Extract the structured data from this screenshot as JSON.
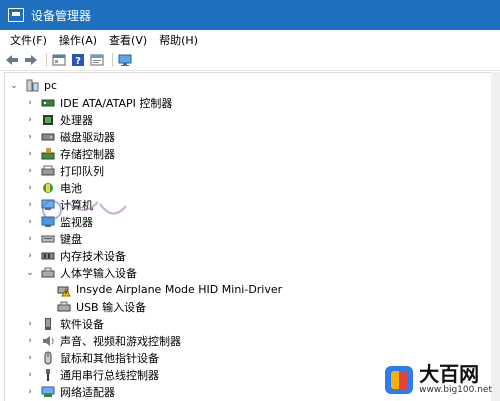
{
  "window": {
    "title": "设备管理器"
  },
  "menu": [
    "文件(F)",
    "操作(A)",
    "查看(V)",
    "帮助(H)"
  ],
  "toolbar": [
    "back-arrow-icon",
    "forward-arrow-icon",
    "properties-icon",
    "help-icon",
    "update-driver-icon",
    "monitor-icon"
  ],
  "tree": {
    "root": "pc",
    "items": [
      {
        "label": "IDE ATA/ATAPI 控制器",
        "icon": "ide-controller-icon",
        "expanded": false
      },
      {
        "label": "处理器",
        "icon": "processor-icon",
        "expanded": false
      },
      {
        "label": "磁盘驱动器",
        "icon": "disk-drive-icon",
        "expanded": false
      },
      {
        "label": "存储控制器",
        "icon": "storage-controller-icon",
        "expanded": false
      },
      {
        "label": "打印队列",
        "icon": "printer-icon",
        "expanded": false
      },
      {
        "label": "电池",
        "icon": "battery-icon",
        "expanded": false
      },
      {
        "label": "计算机",
        "icon": "computer-icon",
        "expanded": false
      },
      {
        "label": "监视器",
        "icon": "monitor-icon",
        "expanded": false
      },
      {
        "label": "键盘",
        "icon": "keyboard-icon",
        "expanded": false
      },
      {
        "label": "内存技术设备",
        "icon": "memory-icon",
        "expanded": false
      },
      {
        "label": "人体学输入设备",
        "icon": "hid-icon",
        "expanded": true,
        "children": [
          {
            "label": "Insyde Airplane Mode HID Mini-Driver",
            "icon": "warning-device-icon"
          },
          {
            "label": "USB 输入设备",
            "icon": "hid-device-icon"
          }
        ]
      },
      {
        "label": "软件设备",
        "icon": "software-device-icon",
        "expanded": false
      },
      {
        "label": "声音、视频和游戏控制器",
        "icon": "sound-icon",
        "expanded": false
      },
      {
        "label": "鼠标和其他指针设备",
        "icon": "mouse-icon",
        "expanded": false
      },
      {
        "label": "通用串行总线控制器",
        "icon": "usb-icon",
        "expanded": false
      },
      {
        "label": "网络适配器",
        "icon": "network-adapter-icon",
        "expanded": false
      }
    ]
  },
  "branding": {
    "name": "大百网",
    "site": "www.big100.net"
  },
  "colors": {
    "titlebar": "#1e6fbe",
    "selection": "#cce8ff"
  }
}
